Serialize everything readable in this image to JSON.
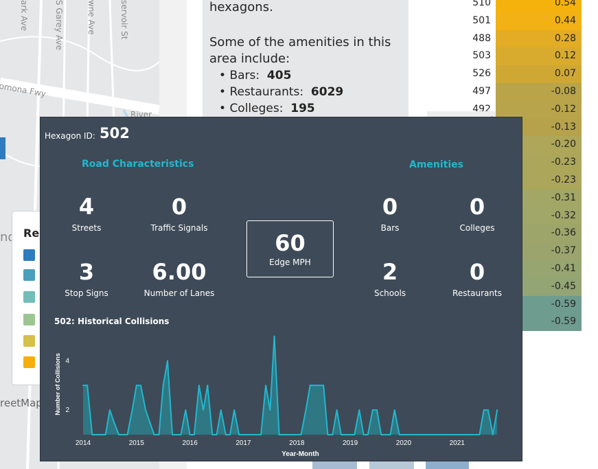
{
  "map": {
    "roads": [
      "ark Ave",
      "S Garey Ave",
      "wne Ave",
      "servoir St",
      "omona Fwy",
      "River"
    ],
    "attribution": "reetMap",
    "partial_label": "nd"
  },
  "summary": {
    "line1": "hexagons.",
    "line2": "Some of the amenities in this area include:",
    "amenities": [
      {
        "label": "Bars:",
        "value": "405"
      },
      {
        "label": "Restaurants:",
        "value": "6029"
      },
      {
        "label": "Colleges:",
        "value": "195"
      }
    ]
  },
  "table": {
    "rows": [
      {
        "id": "510",
        "val": "0.54",
        "color": "#f5b20c"
      },
      {
        "id": "501",
        "val": "0.44",
        "color": "#f2b114"
      },
      {
        "id": "488",
        "val": "0.28",
        "color": "#e3ac25"
      },
      {
        "id": "503",
        "val": "0.12",
        "color": "#d8aa2e"
      },
      {
        "id": "526",
        "val": "0.07",
        "color": "#cea833"
      },
      {
        "id": "497",
        "val": "-0.08",
        "color": "#b9a44a"
      },
      {
        "id": "492",
        "val": "-0.12",
        "color": "#b8a54b"
      },
      {
        "id": "",
        "val": "-0.13",
        "color": "#b6a24b"
      },
      {
        "id": "",
        "val": "-0.20",
        "color": "#aea658"
      },
      {
        "id": "",
        "val": "-0.23",
        "color": "#aca65a"
      },
      {
        "id": "",
        "val": "-0.23",
        "color": "#aca65a"
      },
      {
        "id": "",
        "val": "-0.31",
        "color": "#a2a766"
      },
      {
        "id": "",
        "val": "-0.32",
        "color": "#a0a768"
      },
      {
        "id": "",
        "val": "-0.36",
        "color": "#9da56b"
      },
      {
        "id": "",
        "val": "-0.37",
        "color": "#9ba46d"
      },
      {
        "id": "",
        "val": "-0.41",
        "color": "#97a571"
      },
      {
        "id": "",
        "val": "-0.45",
        "color": "#93a475"
      },
      {
        "id": "",
        "val": "-0.59",
        "color": "#6e9c8e"
      },
      {
        "id": "",
        "val": "-0.59",
        "color": "#6e9c8e"
      }
    ]
  },
  "legend": {
    "title": "Re",
    "swatches": [
      "#2e7cbf",
      "#4a9fbc",
      "#73bdb9",
      "#9cc690",
      "#d4c04a",
      "#f5ae0b"
    ]
  },
  "tooltip": {
    "hexagon_label": "Hexagon ID:",
    "hexagon_id": "502",
    "road_title": "Road Characteristics",
    "amenities_title": "Amenities",
    "kpis": {
      "streets": {
        "value": "4",
        "label": "Streets"
      },
      "signals": {
        "value": "0",
        "label": "Traffic Signals"
      },
      "stops": {
        "value": "3",
        "label": "Stop Signs"
      },
      "lanes": {
        "value": "6.00",
        "label": "Number of Lanes"
      },
      "mph": {
        "value": "60",
        "label": "Edge MPH"
      },
      "bars": {
        "value": "0",
        "label": "Bars"
      },
      "colleges": {
        "value": "0",
        "label": "Colleges"
      },
      "schools": {
        "value": "2",
        "label": "Schools"
      },
      "restaurants": {
        "value": "0",
        "label": "Restaurants"
      }
    },
    "chart_title": "502: Historical Collisions"
  },
  "colors": {
    "accent": "#22b7cf",
    "tooltip_bg": "#3e4a57"
  },
  "chart_data": {
    "type": "area",
    "title": "502: Historical Collisions",
    "xlabel": "Year-Month",
    "ylabel": "Number of Collisions",
    "x_ticks": [
      "2014",
      "2015",
      "2016",
      "2017",
      "2018",
      "2019",
      "2020",
      "2021"
    ],
    "y_ticks": [
      2,
      4
    ],
    "xlim": [
      2014.0,
      2021.8
    ],
    "ylim": [
      1,
      5.1
    ],
    "x": [
      2014.0,
      2014.08,
      2014.17,
      2014.25,
      2014.33,
      2014.42,
      2014.5,
      2014.58,
      2014.67,
      2014.75,
      2014.83,
      2014.92,
      2015.0,
      2015.08,
      2015.17,
      2015.25,
      2015.33,
      2015.42,
      2015.5,
      2015.58,
      2015.67,
      2015.75,
      2015.83,
      2015.92,
      2016.0,
      2016.08,
      2016.17,
      2016.25,
      2016.33,
      2016.42,
      2016.5,
      2016.58,
      2016.67,
      2016.75,
      2016.83,
      2016.92,
      2017.0,
      2017.08,
      2017.17,
      2017.25,
      2017.33,
      2017.42,
      2017.5,
      2017.58,
      2017.67,
      2017.75,
      2017.83,
      2017.92,
      2018.0,
      2018.08,
      2018.17,
      2018.25,
      2018.33,
      2018.42,
      2018.5,
      2018.58,
      2018.67,
      2018.75,
      2018.83,
      2018.92,
      2019.0,
      2019.08,
      2019.17,
      2019.25,
      2019.33,
      2019.42,
      2019.5,
      2019.58,
      2019.67,
      2019.75,
      2019.83,
      2019.92,
      2020.0,
      2020.08,
      2020.17,
      2020.25,
      2020.33,
      2020.42,
      2020.5,
      2020.58,
      2020.67,
      2020.75,
      2020.83,
      2020.92,
      2021.0,
      2021.08,
      2021.17,
      2021.25,
      2021.33,
      2021.42,
      2021.5,
      2021.58,
      2021.67,
      2021.75
    ],
    "y": [
      3,
      3,
      1,
      1,
      1,
      1,
      2,
      1.5,
      1,
      1,
      1,
      2,
      3,
      3,
      2,
      1.5,
      1,
      1,
      3,
      4,
      1,
      1,
      1,
      2,
      1,
      1,
      3,
      2,
      3,
      1,
      1,
      2,
      1,
      1,
      2,
      1,
      1,
      1,
      1,
      1,
      1,
      3,
      2,
      5,
      1,
      1,
      1,
      1,
      1,
      1,
      2,
      3,
      3,
      3,
      3,
      1,
      1,
      2,
      1,
      1,
      1,
      1,
      2,
      1,
      1,
      2,
      2,
      1,
      1,
      1,
      2,
      1,
      1,
      1,
      1,
      1,
      1,
      1,
      1,
      1,
      1,
      1,
      1,
      1,
      1,
      1,
      1,
      1,
      1,
      1,
      2,
      2,
      1,
      2
    ]
  }
}
